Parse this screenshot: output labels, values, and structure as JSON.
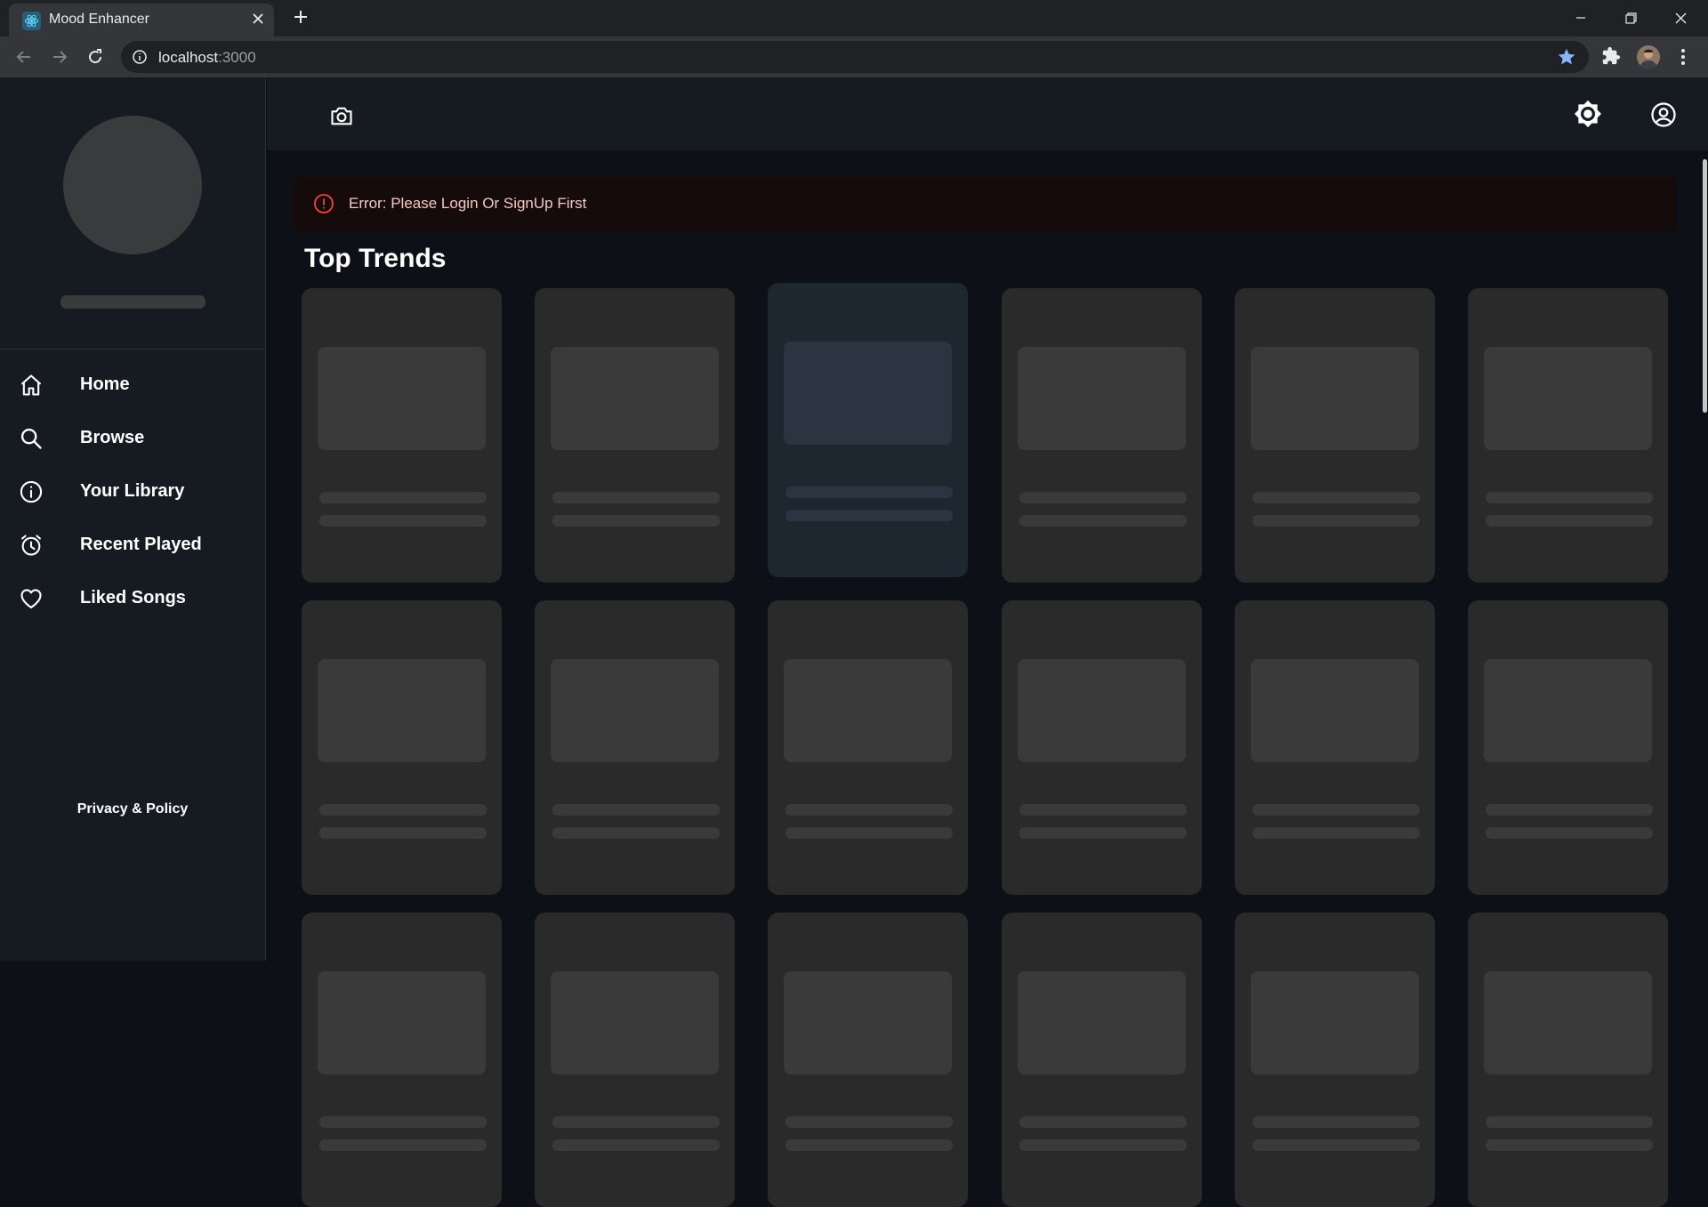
{
  "browser": {
    "tab_title": "Mood Enhancer",
    "url_host": "localhost",
    "url_port": ":3000"
  },
  "sidebar": {
    "items": [
      {
        "label": "Home",
        "icon": "home-icon"
      },
      {
        "label": "Browse",
        "icon": "search-icon"
      },
      {
        "label": "Your Library",
        "icon": "info-icon"
      },
      {
        "label": "Recent Played",
        "icon": "alarm-clock-icon"
      },
      {
        "label": "Liked Songs",
        "icon": "heart-icon"
      }
    ],
    "footer_link": "Privacy & Policy"
  },
  "topbar": {
    "icons": [
      "camera-icon",
      "brightness-icon",
      "account-circle-icon"
    ]
  },
  "error": {
    "message": "Error: Please Login Or SignUp First",
    "color": "#f44336"
  },
  "main": {
    "section_title": "Top Trends"
  },
  "colors": {
    "background": "#0d1117",
    "panel": "#161b22",
    "card": "#2a2a2b",
    "skeleton": "#3a3a3b",
    "bookmark_star": "#8ab4f8"
  }
}
